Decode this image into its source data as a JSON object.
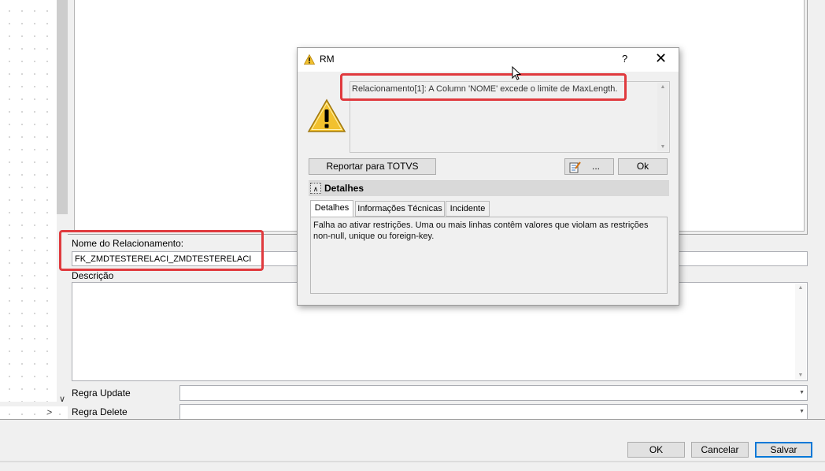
{
  "form": {
    "relationship_name_label": "Nome do Relacionamento:",
    "relationship_name_value": "FK_ZMDTESTERELACI_ZMDTESTERELACI",
    "description_label": "Descrição",
    "update_rule_label": "Regra Update",
    "delete_rule_label": "Regra Delete"
  },
  "footer": {
    "ok_label": "OK",
    "cancel_label": "Cancelar",
    "save_label": "Salvar"
  },
  "dialog": {
    "title": "RM",
    "help": "?",
    "close": "✕",
    "message": "Relacionamento[1]: A Column 'NOME' excede o limite de MaxLength.",
    "report_label": "Reportar para TOTVS",
    "more_label": "...",
    "ok_label": "Ok",
    "details_label": "Detalhes",
    "tabs": [
      {
        "label": "Detalhes"
      },
      {
        "label": "Informações Técnicas"
      },
      {
        "label": "Incidente"
      }
    ],
    "details_text": "Falha ao ativar restrições. Uma ou mais linhas contêm valores que violam as restrições non-null, unique ou foreign-key."
  },
  "icons": {
    "warning": "warning-icon",
    "report": "notepad-icon"
  },
  "colors": {
    "highlight": "#e03a3e",
    "focus": "#0078d7",
    "warning_yellow": "#f2c12e"
  }
}
